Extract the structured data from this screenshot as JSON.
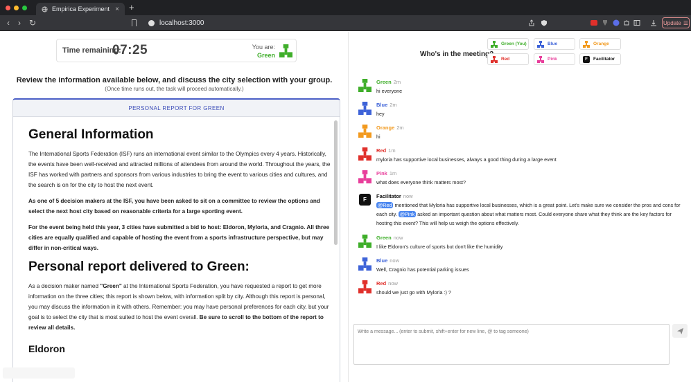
{
  "browser": {
    "tab_title": "Empirica Experiment",
    "url": "localhost:3000",
    "update_label": "Update",
    "traffic_colors": [
      "#ff5f57",
      "#febc2e",
      "#28c840"
    ]
  },
  "timer": {
    "label": "Time remaining:",
    "value": "07:25",
    "you_are_label": "You are:",
    "you_are_name": "Green"
  },
  "instructions": {
    "title": "Review the information available below, and discuss the city selection with your group.",
    "subtitle": "(Once time runs out, the task will proceed automatically.)"
  },
  "report": {
    "header": "PERSONAL REPORT FOR GREEN",
    "h1": "General Information",
    "p1": "The International Sports Federation (ISF) runs an international event similar to the Olympics every 4 years. Historically, the events have been well-received and attracted millions of attendees from around the world. Throughout the years, the ISF has worked with partners and sponsors from various industries to bring the event to various cities and cultures, and the search is on for the city to host the next event.",
    "p2": "As one of 5 decision makers at the ISF, you have been asked to sit on a committee to review the options and select the next host city based on reasonable criteria for a large sporting event.",
    "p3": "For the event being held this year, 3 cities have submitted a bid to host: Eldoron, Myloria, and Cragnio. All three cities are equally qualified and capable of hosting the event from a sports infrastructure perspective, but may differ in non-critical ways.",
    "h2": "Personal report delivered to Green:",
    "p4_a": "As a decision maker named ",
    "p4_name": "\"Green\"",
    "p4_b": " at the International Sports Federation, you have requested a report to get more information on the three cities; this report is shown below, with information split by city. Although this report is personal, you may discuss the information in it with others. Remember: you may have personal preferences for each city, but your goal is to select the city that is most suited to host the event overall. ",
    "p4_bold": "Be sure to scroll to the bottom of the report to review all details.",
    "h3": "Eldoron"
  },
  "meeting": {
    "label": "Who's in the meeting?",
    "participants": [
      {
        "name": "Green (You)",
        "color": "#3fae2a"
      },
      {
        "name": "Blue",
        "color": "#3e63d8"
      },
      {
        "name": "Orange",
        "color": "#f29a1f"
      },
      {
        "name": "Red",
        "color": "#e0302b"
      },
      {
        "name": "Pink",
        "color": "#e83e9b"
      },
      {
        "name": "Facilitator",
        "color": "#111111"
      }
    ],
    "facilitator_initial": "F"
  },
  "messages": [
    {
      "author": "Green",
      "time": "2m",
      "text": "hi everyone",
      "color": "#3fae2a"
    },
    {
      "author": "Blue",
      "time": "2m",
      "text": "hey",
      "color": "#3e63d8"
    },
    {
      "author": "Orange",
      "time": "2m",
      "text": "hi",
      "color": "#f29a1f"
    },
    {
      "author": "Red",
      "time": "1m",
      "text": "myloria has supportive local businesses, always a good thing during a large event",
      "color": "#e0302b"
    },
    {
      "author": "Pink",
      "time": "1m",
      "text": "what does everyone think matters most?",
      "color": "#e83e9b"
    },
    {
      "author": "Facilitator",
      "time": "now",
      "color": "#111111",
      "mention1": "@Red",
      "text_a": " mentioned that Myloria has supportive local businesses, which is a great point. Let's make sure we consider the pros and cons for each city. ",
      "mention2": "@Pink",
      "text_b": " asked an important question about what matters most. Could everyone share what they think are the key factors for hosting this event? This will help us weigh the options effectively."
    },
    {
      "author": "Green",
      "time": "now",
      "text": "I like Eldoron's culture of sports but don't like the humidity",
      "color": "#3fae2a"
    },
    {
      "author": "Blue",
      "time": "now",
      "text": "Well, Cragnio has potential parking issues",
      "color": "#3e63d8"
    },
    {
      "author": "Red",
      "time": "now",
      "text": "should we just go with Myloria :) ?",
      "color": "#e0302b"
    }
  ],
  "compose": {
    "placeholder": "Write a message... (enter to submit, shift+enter for new line, @ to tag someone)"
  }
}
